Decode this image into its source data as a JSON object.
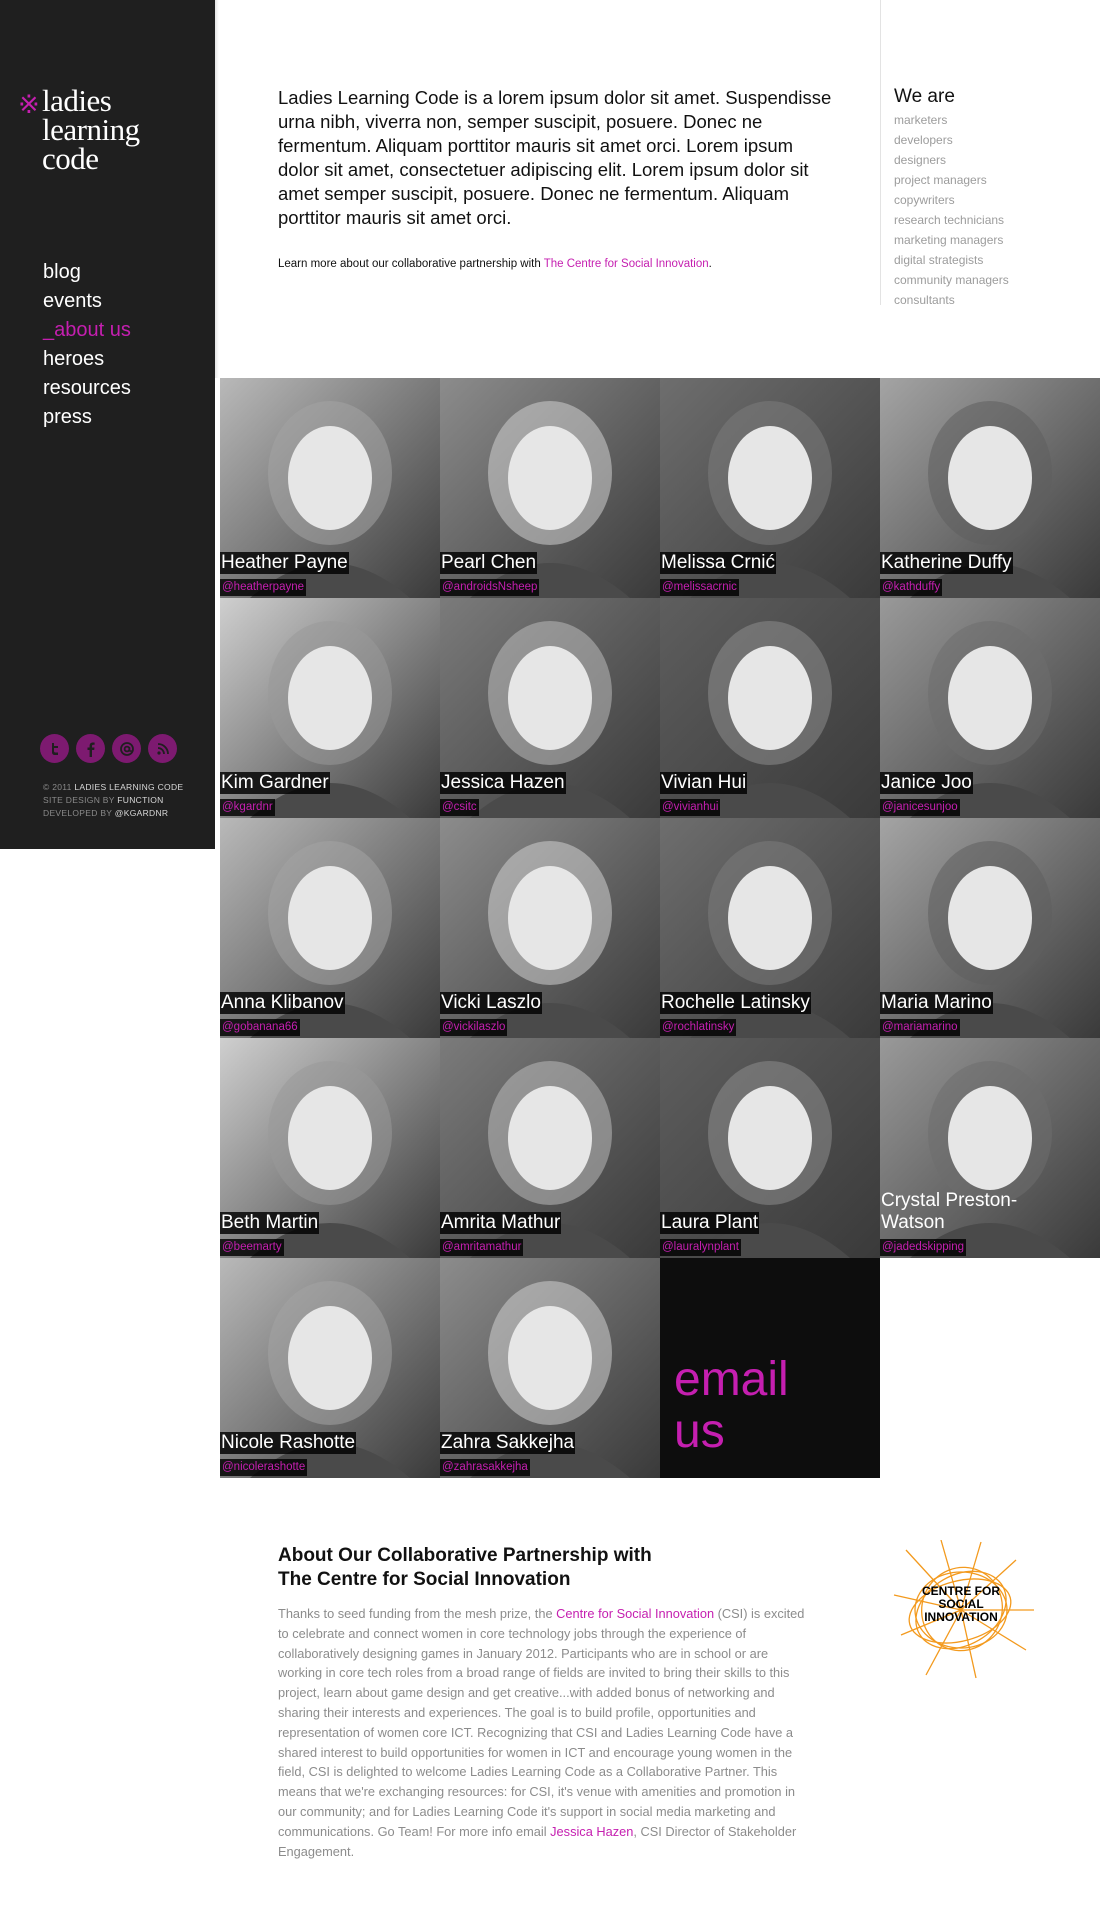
{
  "brand": {
    "logo_mark": "※",
    "logo_lines": [
      "ladies",
      "learning",
      "code"
    ],
    "accent": "#c51fb0",
    "sidebar_bg": "#1f1f1f"
  },
  "nav": {
    "items": [
      {
        "label": "blog"
      },
      {
        "label": "events"
      },
      {
        "label": "_about us",
        "active": true
      },
      {
        "label": "heroes"
      },
      {
        "label": "resources"
      },
      {
        "label": "press"
      }
    ]
  },
  "social": [
    {
      "icon": "twitter-icon"
    },
    {
      "icon": "facebook-icon"
    },
    {
      "icon": "email-icon"
    },
    {
      "icon": "rss-icon"
    }
  ],
  "credits": {
    "line1": "© 2011",
    "line1_b": "Ladies Learning Code",
    "line2": "Site design by",
    "line2_b": "Function",
    "line3": "Developed by",
    "line3_b": "@kgardnr"
  },
  "intro": {
    "text": "Ladies Learning Code is a lorem ipsum dolor sit amet. Suspendisse urna nibh, viverra non, semper suscipit, posuere. Donec ne  fermentum. Aliquam porttitor mauris sit amet orci. Lorem ipsum dolor sit amet, consectetuer adipiscing elit. Lorem ipsum dolor sit amet semper suscipit, posuere. Donec ne fermentum. Aliquam porttitor mauris sit amet orci.",
    "partner_prefix": "Learn more about our collaborative partnership with ",
    "partner_link": "The Centre for Social Innovation",
    "partner_suffix": "."
  },
  "we_are": {
    "title": "We are",
    "items": [
      "marketers",
      "developers",
      "designers",
      "project managers",
      "copywriters",
      "research technicians",
      "marketing managers",
      "digital strategists",
      "community managers",
      "consultants"
    ]
  },
  "team": [
    {
      "name": "Heather Payne",
      "handle": "@heatherpayne"
    },
    {
      "name": "Pearl Chen",
      "handle": "@androidsNsheep"
    },
    {
      "name": "Melissa Crnić",
      "handle": "@melissacrnic"
    },
    {
      "name": "Katherine Duffy",
      "handle": "@kathduffy"
    },
    {
      "name": "Kim Gardner",
      "handle": "@kgardnr"
    },
    {
      "name": "Jessica Hazen",
      "handle": "@csitc"
    },
    {
      "name": "Vivian Hui",
      "handle": "@vivianhui"
    },
    {
      "name": "Janice Joo",
      "handle": "@janicesunjoo"
    },
    {
      "name": "Anna Klibanov",
      "handle": "@gobanana66"
    },
    {
      "name": "Vicki Laszlo",
      "handle": "@vickilaszlo"
    },
    {
      "name": "Rochelle Latinsky",
      "handle": "@rochlatinsky"
    },
    {
      "name": "Maria Marino",
      "handle": "@mariamarino"
    },
    {
      "name": "Beth Martin",
      "handle": "@beemarty"
    },
    {
      "name": "Amrita Mathur",
      "handle": "@amritamathur"
    },
    {
      "name": "Laura Plant",
      "handle": "@lauralynplant"
    },
    {
      "name": "Crystal Preston-Watson",
      "handle": "@jadedskipping"
    },
    {
      "name": "Nicole Rashotte",
      "handle": "@nicolerashotte"
    },
    {
      "name": "Zahra Sakkejha",
      "handle": "@zahrasakkejha"
    }
  ],
  "email_cta": {
    "line1": "email",
    "line2": "us"
  },
  "about": {
    "title_line1": "About Our Collaborative Partnership with",
    "title_line2": "The Centre for Social Innovation",
    "p1": "Thanks to seed funding from the mesh prize, the ",
    "link1": "Centre for Social Innovation",
    "p2": " (CSI) is excited to celebrate and connect women in core technology jobs through the experience of collaboratively designing games in January 2012. Participants who are in school or are working in core tech roles from a broad range of fields are invited to bring their skills to this project, learn about game design and get creative...with added bonus of networking and sharing their interests and experiences. The goal is to build profile, opportunities and representation of women core ICT. Recognizing that CSI and Ladies Learning Code have a shared interest to build opportunities for women in ICT and encourage young women in the field, CSI is delighted to welcome Ladies Learning Code as a Collaborative Partner. This means that we're exchanging resources: for CSI, it's venue with amenities and promotion in our community; and for Ladies Learning Code it's support in social media marketing and communications. Go Team!  For more info email ",
    "link2": "Jessica Hazen",
    "p3": ", CSI Director of Stakeholder Engagement."
  },
  "csi_logo": {
    "lines": [
      "CENTRE FOR",
      "SOCIAL",
      "INNOVATION"
    ],
    "color": "#f39a1e"
  }
}
